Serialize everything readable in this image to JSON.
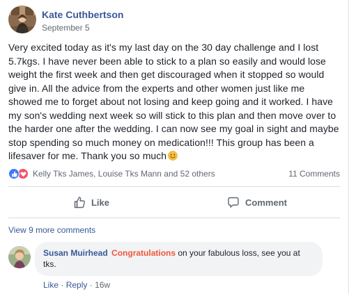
{
  "post": {
    "author": "Kate Cuthbertson",
    "date": "September 5",
    "text": "Very excited today as it's my last day on the 30 day challenge and I lost 5.7kgs. I have never been able to stick to a plan so easily and would lose weight the first week and then get discouraged when it stopped so would give in. All the advice from the experts and other women just like me showed me to forget about not losing and keep going and it worked. I have my son's wedding next week so will stick to this plan and then move over to the harder one after the wedding. I can now see my goal in sight and maybe stop spending so much money on medication!!! This group has been a lifesaver for me. Thank you so much",
    "emoji": "smiling-face-emoji"
  },
  "reactions": {
    "icons": [
      "like-reaction-icon",
      "love-reaction-icon"
    ],
    "names": "Kelly Tks James, Louise Tks Mann and 52 others",
    "comments_count": "11 Comments"
  },
  "actions": {
    "like_label": "Like",
    "comment_label": "Comment"
  },
  "comments": {
    "view_more": "View 9 more comments",
    "items": [
      {
        "author": "Susan Muirhead",
        "highlight": "Congratulations",
        "text": " on your fabulous loss, see you at tks.",
        "like_label": "Like",
        "separator": "·",
        "reply_label": "Reply",
        "time": "16w"
      }
    ]
  },
  "colors": {
    "link_blue": "#385898",
    "highlight_orange": "#f0573c",
    "like_blue": "#3b7cf5",
    "love_red": "#f25268"
  }
}
